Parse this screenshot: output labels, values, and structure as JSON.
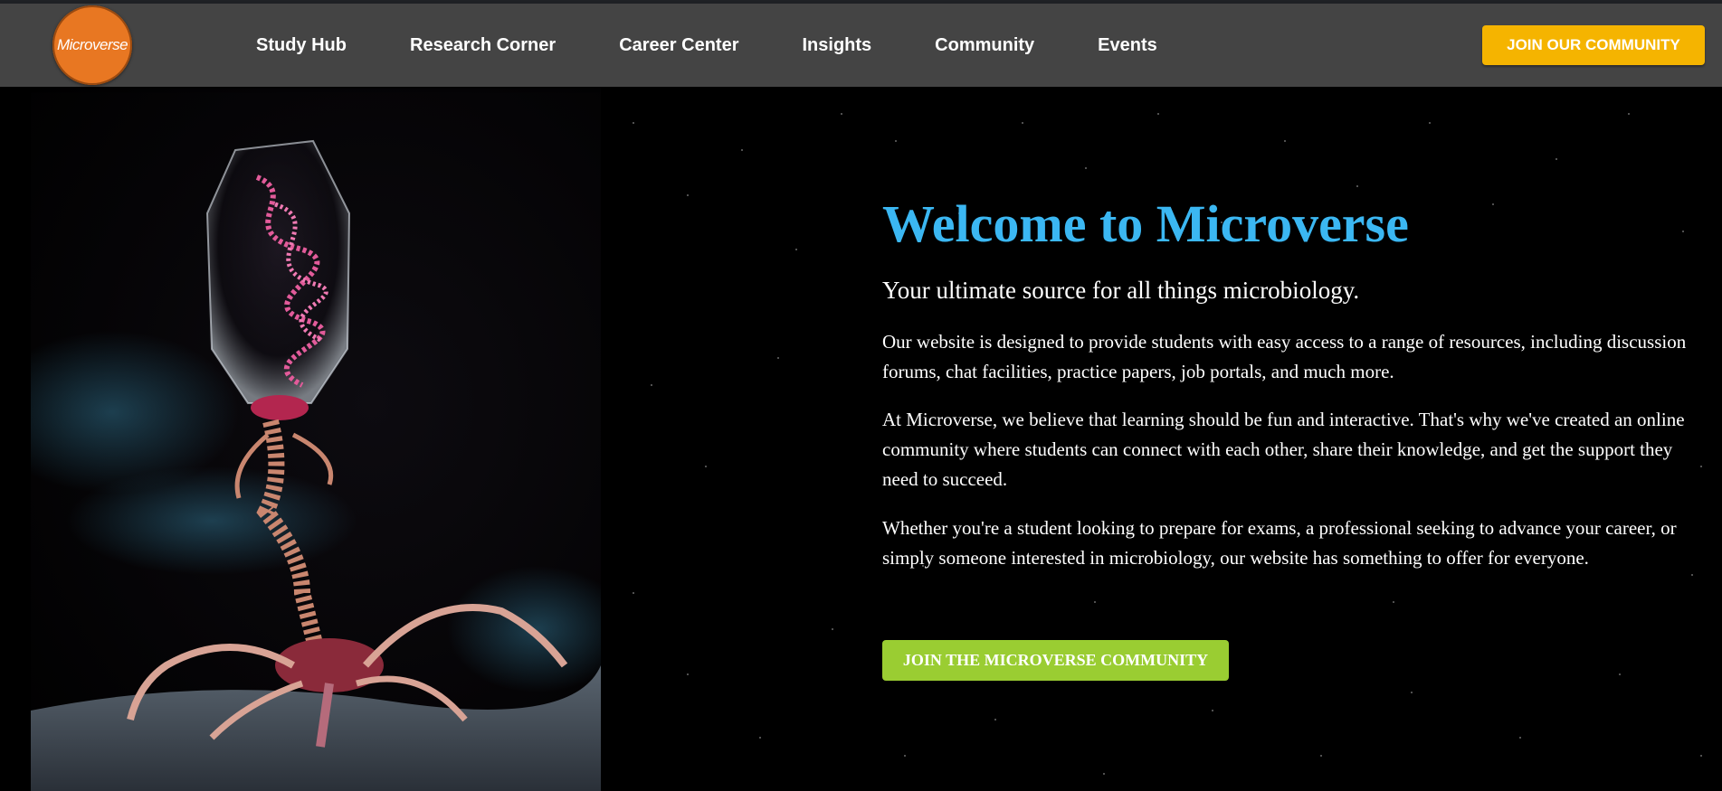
{
  "brand": {
    "logo_text": "Microverse"
  },
  "nav": {
    "items": [
      {
        "label": "Study Hub"
      },
      {
        "label": "Research Corner"
      },
      {
        "label": "Career Center"
      },
      {
        "label": "Insights"
      },
      {
        "label": "Community"
      },
      {
        "label": "Events"
      }
    ],
    "cta_label": "JOIN OUR COMMUNITY"
  },
  "hero": {
    "title": "Welcome to Microverse",
    "subtitle": "Your ultimate source for all things microbiology.",
    "paragraphs": [
      "Our website is designed to provide students with easy access to a range of resources, including discussion forums, chat facilities, practice papers, job portals, and much more.",
      "At Microverse, we believe that learning should be fun and interactive. That's why we've created an online community where students can connect with each other, share their knowledge, and get the support they need to succeed.",
      "Whether you're a student looking to prepare for exams, a professional seeking to advance your career, or simply someone interested in microbiology, our website has something to offer for everyone."
    ],
    "cta_label": "JOIN THE MICROVERSE COMMUNITY"
  },
  "colors": {
    "navbar_bg": "#444444",
    "logo_bg": "#e87722",
    "nav_cta_bg": "#f5b400",
    "hero_title": "#3bb7f2",
    "hero_cta_bg": "#9acd32"
  }
}
